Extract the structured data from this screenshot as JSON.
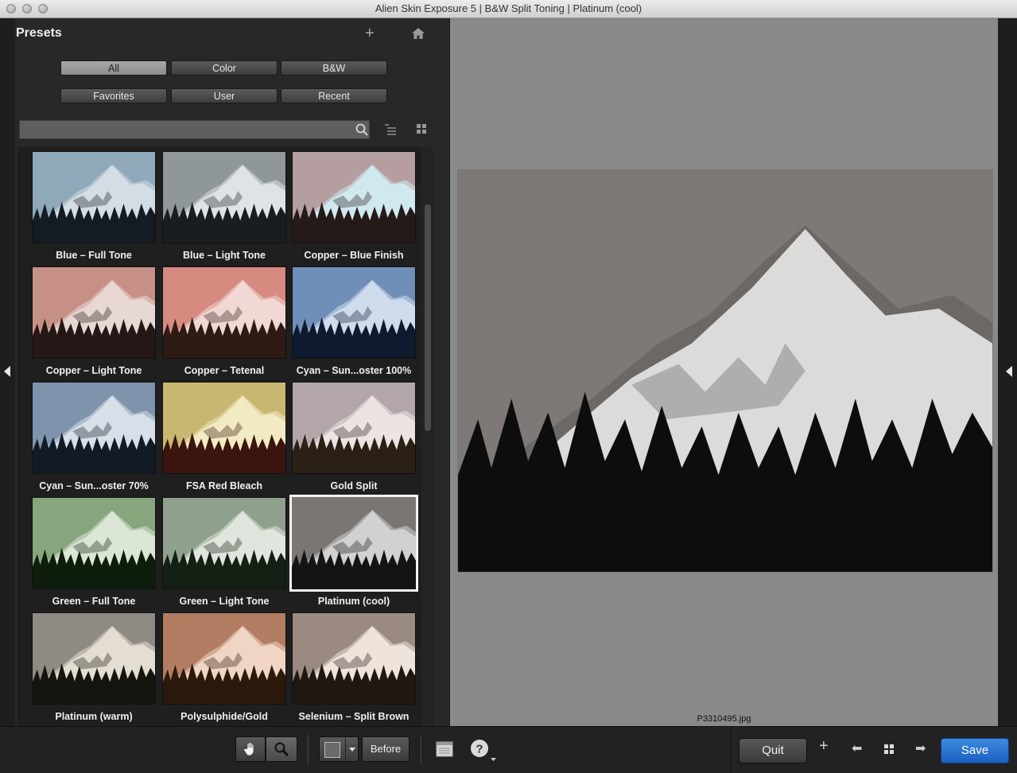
{
  "window": {
    "title": "Alien Skin Exposure 5 | B&W Split Toning | Platinum (cool)"
  },
  "panel": {
    "title": "Presets",
    "filters": [
      "All",
      "Color",
      "B&W",
      "Favorites",
      "User",
      "Recent"
    ],
    "active_filter": "All",
    "search": {
      "value": "",
      "placeholder": ""
    },
    "presets": [
      {
        "label": "Blue – Full Tone",
        "sky": "#8fa9bb",
        "rock": "#d4dde4",
        "trees": "#151b22"
      },
      {
        "label": "Blue – Light Tone",
        "sky": "#8f979b",
        "rock": "#dfe3e5",
        "trees": "#1a1d1f"
      },
      {
        "label": "Copper – Blue Finish",
        "sky": "#b59ea0",
        "rock": "#cfe9ee",
        "trees": "#241a18"
      },
      {
        "label": "Copper – Light Tone",
        "sky": "#c79086",
        "rock": "#e7d8d5",
        "trees": "#241715"
      },
      {
        "label": "Copper – Tetenal",
        "sky": "#d68a80",
        "rock": "#f2d8d4",
        "trees": "#2e1b14"
      },
      {
        "label": "Cyan – Sun...oster 100%",
        "sky": "#6f8fb8",
        "rock": "#cfdcec",
        "trees": "#0e1a2d"
      },
      {
        "label": "Cyan – Sun...oster  70%",
        "sky": "#7f93ad",
        "rock": "#d7dfe8",
        "trees": "#121a26"
      },
      {
        "label": "FSA Red Bleach",
        "sky": "#c8b770",
        "rock": "#f2eac2",
        "trees": "#3a150d"
      },
      {
        "label": "Gold Split",
        "sky": "#b3a6a8",
        "rock": "#ebe4e3",
        "trees": "#2a2014"
      },
      {
        "label": "Green – Full Tone",
        "sky": "#88a67e",
        "rock": "#dbe6d6",
        "trees": "#0e1d0c"
      },
      {
        "label": "Green – Light Tone",
        "sky": "#8fa08c",
        "rock": "#e0e6dd",
        "trees": "#142014"
      },
      {
        "label": "Platinum (cool)",
        "sky": "#7a7674",
        "rock": "#d2d1cf",
        "trees": "#141414"
      },
      {
        "label": "Platinum (warm)",
        "sky": "#8f8a83",
        "rock": "#e3ddd2",
        "trees": "#16140f"
      },
      {
        "label": "Polysulphide/Gold",
        "sky": "#b27d63",
        "rock": "#f0d4c4",
        "trees": "#2b190c"
      },
      {
        "label": "Selenium – Split Brown",
        "sky": "#9a8a80",
        "rock": "#eee4dc",
        "trees": "#1f1711"
      }
    ],
    "selected_index": 11
  },
  "preview": {
    "filename": "P3310495.jpg",
    "sky": "#7e7977",
    "rock": "#dcdbd9",
    "shadow": "#5d5b59",
    "trees": "#0d0d0d"
  },
  "toolbar": {
    "before_label": "Before",
    "quit_label": "Quit",
    "save_label": "Save",
    "add_glyph": "+",
    "prev_glyph": "⬅",
    "grid_glyph": "▪▪",
    "next_glyph": "➡"
  },
  "colors": {
    "accent": "#2a72d4",
    "selected_border": "#f4f4f4"
  }
}
